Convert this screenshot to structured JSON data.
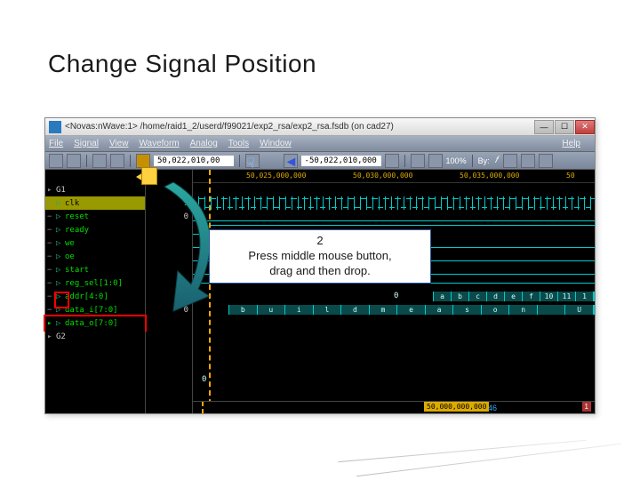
{
  "slide": {
    "title": "Change Signal Position"
  },
  "window": {
    "title": "<Novas:nWave:1> /home/raid1_2/userd/f99021/exp2_rsa/exp2_rsa.fsdb (on cad27)"
  },
  "menu": {
    "file": "File",
    "signal": "Signal",
    "view": "View",
    "waveform": "Waveform",
    "analog": "Analog",
    "tools": "Tools",
    "window": "Window",
    "help": "Help"
  },
  "toolbar": {
    "cursor_time": "50,022,010,00",
    "delta_time": "-50,022,010,000",
    "zoom": "100%",
    "by_label": "By:"
  },
  "ruler": {
    "t1": "50,025,000,000",
    "t2": "50,030,000,000",
    "t3": "50,035,000,000",
    "t4": "50"
  },
  "groups": {
    "g1": "G1",
    "g2": "G2"
  },
  "signals": {
    "clk": "clk",
    "reset": "reset",
    "ready": "ready",
    "we": "we",
    "oe": "oe",
    "start": "start",
    "reg_sel": "reg_sel[1:0]",
    "addr": "addr[4:0]",
    "data_i": "data_i[7:0]",
    "data_o": "data_o[7:0]"
  },
  "values": {
    "clk": "1",
    "reset": "0",
    "zero1": "0",
    "zero2": "0",
    "zero3": "0"
  },
  "bus_cells": {
    "addr": [
      "a",
      "b",
      "c",
      "d",
      "e",
      "f",
      "10",
      "11",
      "1"
    ],
    "data_i": [
      "b",
      "u",
      "i",
      "l",
      "d",
      "m",
      "e",
      "a",
      "s",
      "o",
      "n",
      "",
      "U"
    ]
  },
  "callout": {
    "num": "2",
    "line1": "Press middle mouse button,",
    "line2": "drag and then drop."
  },
  "bottom": {
    "time": "50,000,000,000",
    "page": "46",
    "mark": "1"
  }
}
